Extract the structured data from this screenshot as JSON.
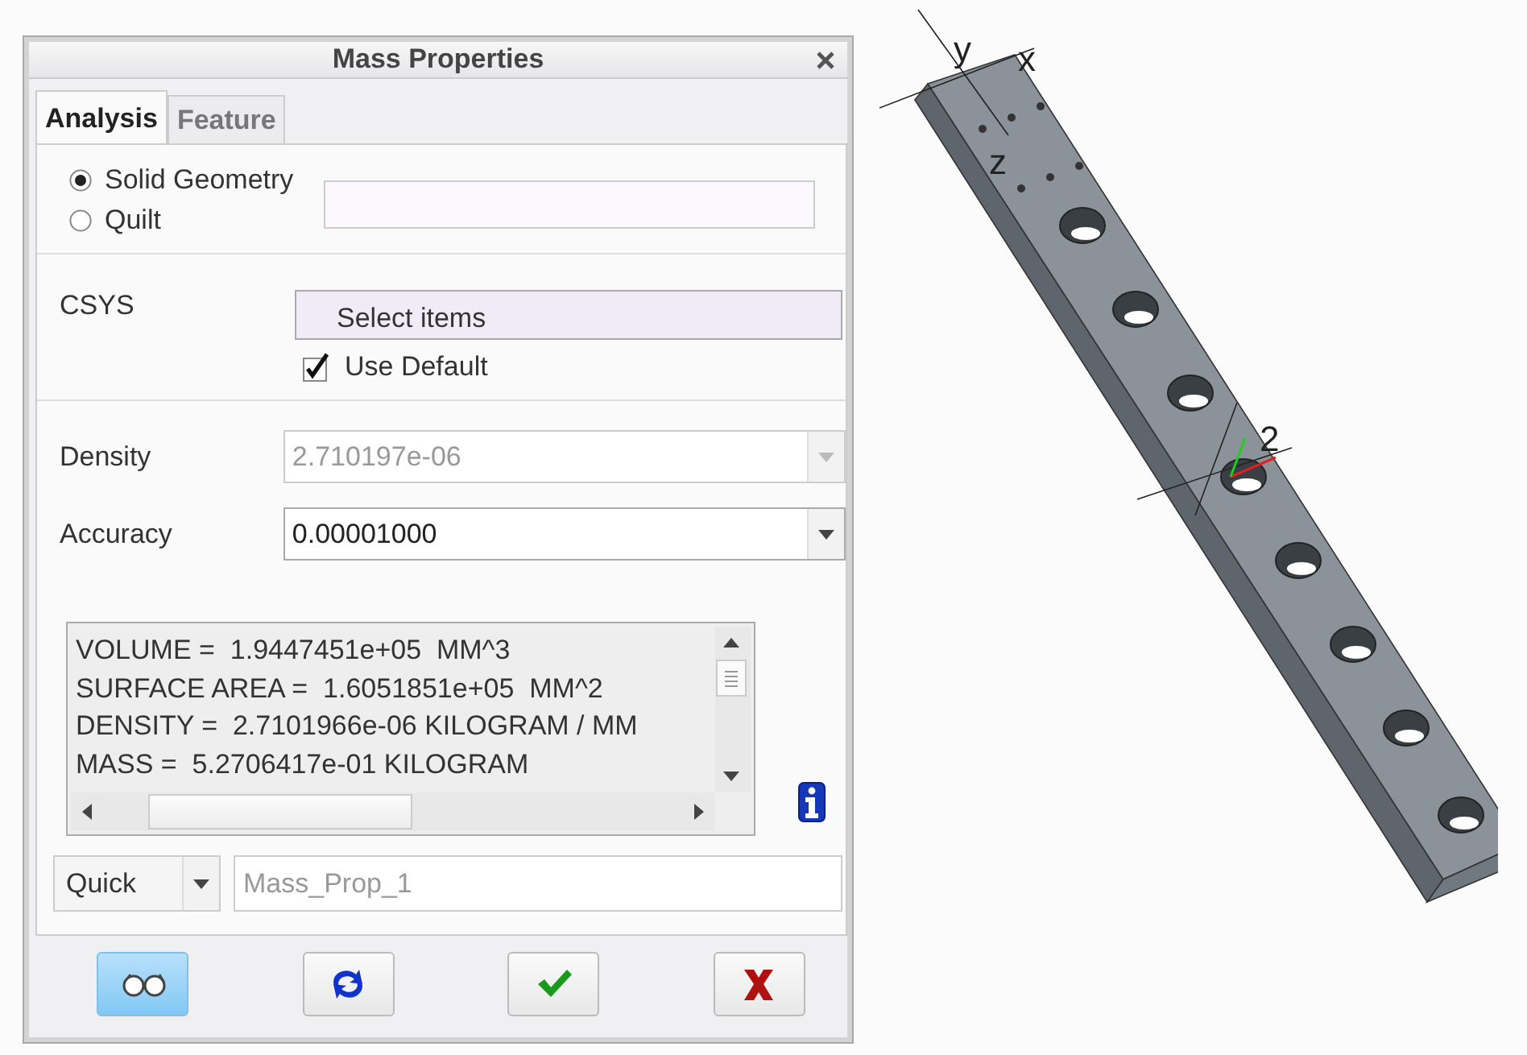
{
  "window": {
    "title": "Mass Properties"
  },
  "tabs": [
    {
      "label": "Analysis",
      "selected": true
    },
    {
      "label": "Feature",
      "selected": false
    }
  ],
  "geometry": {
    "options": [
      {
        "label": "Solid Geometry",
        "selected": true
      },
      {
        "label": "Quilt",
        "selected": false
      }
    ]
  },
  "csys": {
    "label": "CSYS",
    "collector": "Select items",
    "use_default": {
      "label": "Use Default",
      "checked": true
    }
  },
  "density": {
    "label": "Density",
    "value": "2.710197e-06",
    "disabled": true
  },
  "accuracy": {
    "label": "Accuracy",
    "value": "0.00001000",
    "disabled": false
  },
  "results": {
    "lines": [
      "VOLUME =  1.9447451e+05  MM^3",
      "SURFACE AREA =  1.6051851e+05  MM^2",
      "DENSITY =  2.7101966e-06 KILOGRAM / MM",
      "MASS =  5.2706417e-01 KILOGRAM"
    ]
  },
  "feature": {
    "mode": "Quick",
    "name": "Mass_Prop_1"
  },
  "buttons": [
    {
      "kind": "preview",
      "selected": true
    },
    {
      "kind": "repeat",
      "selected": false
    },
    {
      "kind": "ok",
      "selected": false
    },
    {
      "kind": "cancel",
      "selected": false
    }
  ],
  "model": {
    "axis_labels": [
      "y",
      "x",
      "z",
      "2"
    ]
  }
}
